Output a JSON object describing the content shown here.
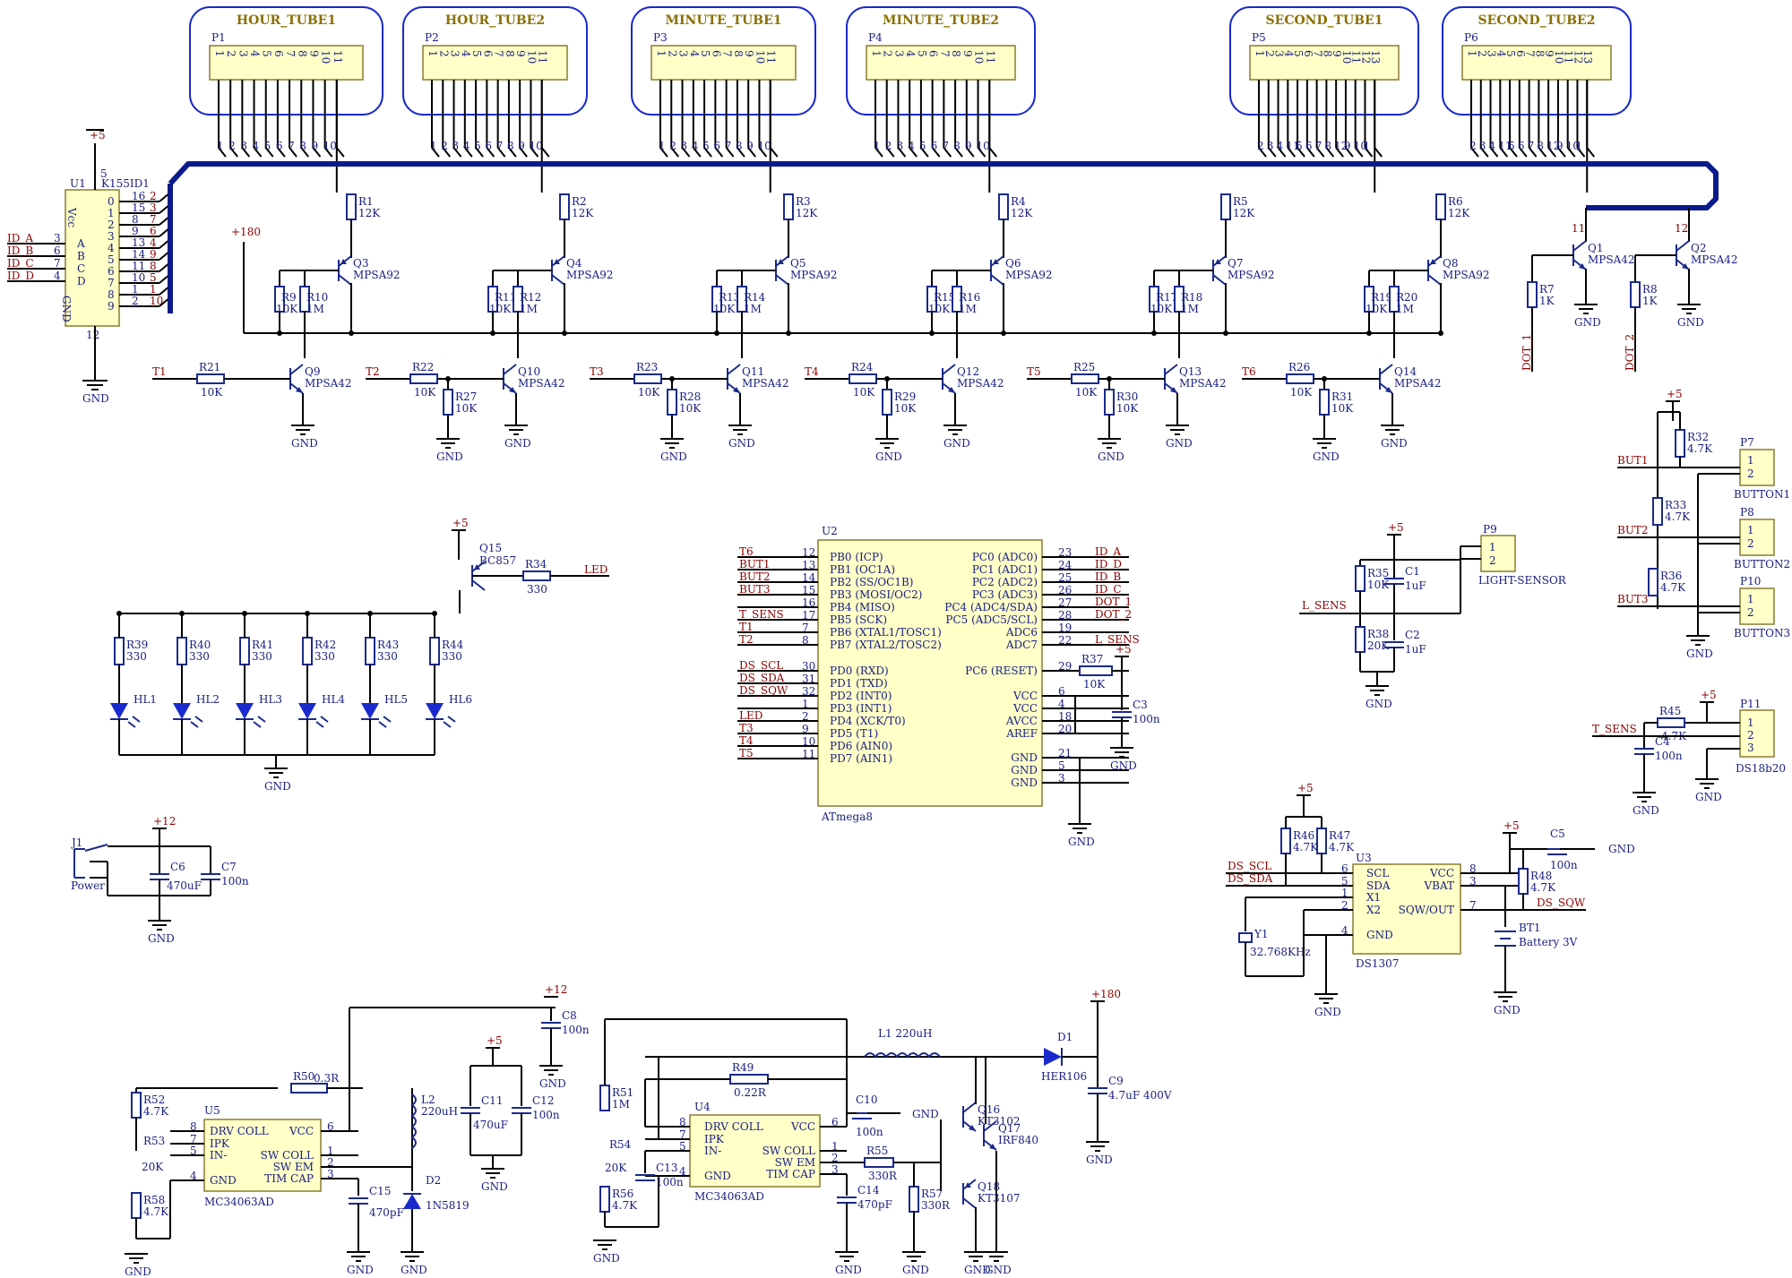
{
  "tubes": [
    {
      "title": "HOUR_TUBE1",
      "ref": "P1"
    },
    {
      "title": "HOUR_TUBE2",
      "ref": "P2"
    },
    {
      "title": "MINUTE_TUBE1",
      "ref": "P3"
    },
    {
      "title": "MINUTE_TUBE2",
      "ref": "P4"
    },
    {
      "title": "SECOND_TUBE1",
      "ref": "P5"
    },
    {
      "title": "SECOND_TUBE2",
      "ref": "P6"
    }
  ],
  "tube_pins_11": [
    "1",
    "2",
    "3",
    "4",
    "5",
    "6",
    "7",
    "8",
    "9",
    "10",
    "11"
  ],
  "tube_pins_13": [
    "1",
    "2",
    "3",
    "4",
    "5",
    "6",
    "7",
    "8",
    "9",
    "10",
    "11",
    "12",
    "13"
  ],
  "bus_labels_a": [
    "1",
    "2",
    "3",
    "4",
    "5",
    "6",
    "7",
    "8",
    "9",
    "10"
  ],
  "bus_labels_b": [
    "2",
    "3",
    "4",
    "11",
    "5",
    "6",
    "7",
    "8",
    "12",
    "9",
    "10",
    "1"
  ],
  "power": {
    "p5": "+5",
    "p12": "+12",
    "p180": "+180",
    "gnd": "GND"
  },
  "u1": {
    "ref": "U1",
    "part": "K155ID1",
    "vcc": "Vcc",
    "gnd": "GND",
    "pin5": "5",
    "pin12": "12",
    "inputs": [
      "A",
      "B",
      "C",
      "D"
    ],
    "outputs": [
      "0",
      "1",
      "2",
      "3",
      "4",
      "5",
      "6",
      "7",
      "8",
      "9"
    ],
    "out_pins": [
      "16",
      "15",
      "8",
      "9",
      "13",
      "14",
      "11",
      "10",
      "1",
      "2"
    ],
    "bus_nums": [
      "2",
      "3",
      "7",
      "6",
      "4",
      "9",
      "8",
      "5",
      "1",
      "10"
    ],
    "in_nets": [
      "ID_A",
      "ID_B",
      "ID_C",
      "ID_D"
    ],
    "in_pins": [
      "3",
      "6",
      "7",
      "4"
    ]
  },
  "anode_stages": [
    {
      "r": "R1",
      "rv": "12K",
      "q": "Q3",
      "rb": "R9",
      "rbv": "10K",
      "rc": "R10",
      "rcv": "1M",
      "qn": "Q9",
      "rin": "R21",
      "rinv": "10K",
      "t": "T1",
      "rd": "",
      "rdv": ""
    },
    {
      "r": "R2",
      "rv": "12K",
      "q": "Q4",
      "rb": "R11",
      "rbv": "10K",
      "rc": "R12",
      "rcv": "1M",
      "qn": "Q10",
      "rin": "R22",
      "rinv": "10K",
      "t": "T2",
      "rd": "R27",
      "rdv": "10K"
    },
    {
      "r": "R3",
      "rv": "12K",
      "q": "Q5",
      "rb": "R13",
      "rbv": "10K",
      "rc": "R14",
      "rcv": "1M",
      "qn": "Q11",
      "rin": "R23",
      "rinv": "10K",
      "t": "T3",
      "rd": "R28",
      "rdv": "10K"
    },
    {
      "r": "R4",
      "rv": "12K",
      "q": "Q6",
      "rb": "R15",
      "rbv": "10K",
      "rc": "R16",
      "rcv": "1M",
      "qn": "Q12",
      "rin": "R24",
      "rinv": "10K",
      "t": "T4",
      "rd": "R29",
      "rdv": "10K"
    },
    {
      "r": "R5",
      "rv": "12K",
      "q": "Q7",
      "rb": "R17",
      "rbv": "10K",
      "rc": "R18",
      "rcv": "1M",
      "qn": "Q13",
      "rin": "R25",
      "rinv": "10K",
      "t": "T5",
      "rd": "R30",
      "rdv": "10K"
    },
    {
      "r": "R6",
      "rv": "12K",
      "q": "Q8",
      "rb": "R19",
      "rbv": "10K",
      "rc": "R20",
      "rcv": "1M",
      "qn": "Q14",
      "rin": "R26",
      "rinv": "10K",
      "t": "T6",
      "rd": "R31",
      "rdv": "10K"
    }
  ],
  "mpsa92": "MPSA92",
  "mpsa42": "MPSA42",
  "dots": [
    {
      "q": "Q1",
      "pin": "11",
      "r": "R7",
      "rv": "1K",
      "net": "DOT_1"
    },
    {
      "q": "Q2",
      "pin": "12",
      "r": "R8",
      "rv": "1K",
      "net": "DOT_2"
    }
  ],
  "leds": {
    "q": "Q15",
    "qpart": "BC857",
    "r": "R34",
    "rv": "330",
    "net": "LED",
    "items": [
      {
        "r": "R39",
        "hl": "HL1"
      },
      {
        "r": "R40",
        "hl": "HL2"
      },
      {
        "r": "R41",
        "hl": "HL3"
      },
      {
        "r": "R42",
        "hl": "HL4"
      },
      {
        "r": "R43",
        "hl": "HL5"
      },
      {
        "r": "R44",
        "hl": "HL6"
      }
    ]
  },
  "mcu": {
    "ref": "U2",
    "part": "ATmega8",
    "left": [
      {
        "net": "T6",
        "pin": "12",
        "name": "PB0 (ICP)"
      },
      {
        "net": "BUT1",
        "pin": "13",
        "name": "PB1 (OC1A)"
      },
      {
        "net": "BUT2",
        "pin": "14",
        "name": "PB2 (SS/OC1B)"
      },
      {
        "net": "BUT3",
        "pin": "15",
        "name": "PB3 (MOSI/OC2)"
      },
      {
        "net": "",
        "pin": "16",
        "name": "PB4 (MISO)"
      },
      {
        "net": "T_SENS",
        "pin": "17",
        "name": "PB5 (SCK)"
      },
      {
        "net": "T1",
        "pin": "7",
        "name": "PB6 (XTAL1/TOSC1)"
      },
      {
        "net": "T2",
        "pin": "8",
        "name": "PB7 (XTAL2/TOSC2)"
      },
      {
        "net": "DS_SCL",
        "pin": "30",
        "name": "PD0 (RXD)"
      },
      {
        "net": "DS_SDA",
        "pin": "31",
        "name": "PD1 (TXD)"
      },
      {
        "net": "DS_SQW",
        "pin": "32",
        "name": "PD2 (INT0)"
      },
      {
        "net": "",
        "pin": "1",
        "name": "PD3 (INT1)"
      },
      {
        "net": "LED",
        "pin": "2",
        "name": "PD4 (XCK/T0)"
      },
      {
        "net": "T3",
        "pin": "9",
        "name": "PD5 (T1)"
      },
      {
        "net": "T4",
        "pin": "10",
        "name": "PD6 (AIN0)"
      },
      {
        "net": "T5",
        "pin": "11",
        "name": "PD7 (AIN1)"
      }
    ],
    "right": [
      {
        "net": "ID_A",
        "pin": "23",
        "name": "PC0 (ADC0)"
      },
      {
        "net": "ID_D",
        "pin": "24",
        "name": "PC1 (ADC1)"
      },
      {
        "net": "ID_B",
        "pin": "25",
        "name": "PC2 (ADC2)"
      },
      {
        "net": "ID_C",
        "pin": "26",
        "name": "PC3 (ADC3)"
      },
      {
        "net": "DOT_1",
        "pin": "27",
        "name": "PC4 (ADC4/SDA)"
      },
      {
        "net": "DOT_2",
        "pin": "28",
        "name": "PC5 (ADC5/SCL)"
      },
      {
        "net": "",
        "pin": "19",
        "name": "ADC6"
      },
      {
        "net": "L_SENS",
        "pin": "22",
        "name": "ADC7"
      },
      {
        "net": "",
        "pin": "29",
        "name": "PC6 (RESET)"
      },
      {
        "net": "",
        "pin": "6",
        "name": "VCC"
      },
      {
        "net": "",
        "pin": "4",
        "name": "VCC"
      },
      {
        "net": "",
        "pin": "18",
        "name": "AVCC"
      },
      {
        "net": "",
        "pin": "20",
        "name": "AREF"
      },
      {
        "net": "",
        "pin": "21",
        "name": "GND"
      },
      {
        "net": "",
        "pin": "5",
        "name": "GND"
      },
      {
        "net": "",
        "pin": "3",
        "name": "GND"
      }
    ],
    "r37": "R37",
    "r37v": "10K",
    "c3": "C3",
    "c3v": "100n"
  },
  "light": {
    "ref": "P9",
    "name": "LIGHT-SENSOR",
    "net": "L_SENS",
    "r35": "R35",
    "r35v": "10K",
    "c1": "C1",
    "c1v": "1uF",
    "r38": "R38",
    "r38v": "20K",
    "c2": "C2",
    "c2v": "1uF"
  },
  "buttons": {
    "items": [
      {
        "ref": "P7",
        "name": "BUTTON1",
        "net": "BUT1",
        "r": "R32",
        "rv": "4.7K"
      },
      {
        "ref": "P8",
        "name": "BUTTON2",
        "net": "BUT2",
        "r": "R33",
        "rv": "4.7K"
      },
      {
        "ref": "P10",
        "name": "BUTTON3",
        "net": "BUT3",
        "r": "R36",
        "rv": "4.7K"
      }
    ]
  },
  "ds18": {
    "ref": "P11",
    "name": "DS18b20",
    "net": "T_SENS",
    "r": "R45",
    "rv": "4.7K",
    "c": "C4",
    "cv": "100n"
  },
  "rtc": {
    "ref": "U3",
    "part": "DS1307",
    "pins_l": [
      "SCL",
      "SDA",
      "X1",
      "X2",
      "GND"
    ],
    "pins_r": [
      "VCC",
      "VBAT",
      "SQW/OUT"
    ],
    "nums_l": [
      "6",
      "5",
      "1",
      "2",
      "4"
    ],
    "nums_r": [
      "8",
      "3",
      "7"
    ],
    "r46": "R46",
    "r47": "R47",
    "r48": "R48",
    "rv": "4.7K",
    "c5": "C5",
    "c5v": "100n",
    "y1": "Y1",
    "y1v": "32.768KHz",
    "bt": "BT1",
    "btv": "Battery 3V",
    "scl": "DS_SCL",
    "sda": "DS_SDA",
    "sqw": "DS_SQW"
  },
  "power_in": {
    "j": "J1",
    "name": "Power",
    "c6": "C6",
    "c6v": "470uF",
    "c7": "C7",
    "c7v": "100n"
  },
  "psu1": {
    "ref": "U5",
    "part": "MC34063AD",
    "pins": [
      "DRV COLL",
      "IPK",
      "IN-",
      "GND",
      "VCC",
      "SW COLL",
      "SW EM",
      "TIM CAP"
    ],
    "nums": [
      "8",
      "7",
      "5",
      "4",
      "6",
      "1",
      "2",
      "3"
    ],
    "r50": "R50",
    "r50v": "0.3R",
    "r52": "R52",
    "r52v": "4.7K",
    "r53": "R53",
    "r53v": "20K",
    "r58": "R58",
    "r58v": "4.7K",
    "l2": "L2",
    "l2v": "220uH",
    "c11": "C11",
    "c11v": "470uF",
    "c12": "C12",
    "c12v": "100n",
    "c15": "C15",
    "c15v": "470pF",
    "d2": "D2",
    "d2v": "1N5819",
    "c8": "C8",
    "c8v": "100n"
  },
  "psu2": {
    "ref": "U4",
    "part": "MC34063AD",
    "r49": "R49",
    "r49v": "0.22R",
    "r51": "R51",
    "r51v": "1M",
    "r54": "R54",
    "r54v": "20K",
    "r56": "R56",
    "r56v": "4.7K",
    "c13": "C13",
    "c13v": "100n",
    "c10": "C10",
    "c10v": "100n",
    "c14": "C14",
    "c14v": "470pF",
    "r55": "R55",
    "r55v": "330R",
    "r57": "R57",
    "r57v": "330R",
    "l1": "L1",
    "l1v": "220uH",
    "d1": "D1",
    "d1v": "HER106",
    "c9": "C9",
    "c9v": "4.7uF 400V",
    "q16": "Q16",
    "q16v": "KT3102",
    "q17": "Q17",
    "q17v": "IRF840",
    "q18": "Q18",
    "q18v": "KT3107"
  },
  "colors": {
    "wire": "#000000",
    "bus": "#0b1a8a",
    "ic_fill": "#ffffc8",
    "label": "#1a2080",
    "net": "#8a0000",
    "tube": "#1a2acc"
  }
}
